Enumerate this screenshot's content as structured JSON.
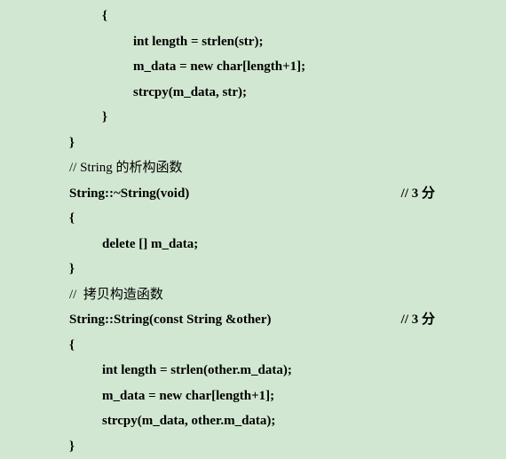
{
  "code": {
    "l1": "{",
    "l2": "int length = strlen(str);",
    "l3": "m_data = new char[length+1];",
    "l4": "strcpy(m_data, str);",
    "l5": "}",
    "l6": "}",
    "l7": "// String 的析构函数",
    "l8": "String::~String(void)",
    "l8_note": "// 3 分",
    "l9": "{",
    "l10": "delete [] m_data;",
    "l11": "}",
    "l12": "//  拷贝构造函数",
    "l13": "String::String(const String &other)",
    "l13_note": "// 3 分",
    "l14": "{",
    "l15": "int length = strlen(other.m_data);",
    "l16": "m_data = new char[length+1];",
    "l17": "strcpy(m_data, other.m_data);",
    "l18": "}"
  }
}
